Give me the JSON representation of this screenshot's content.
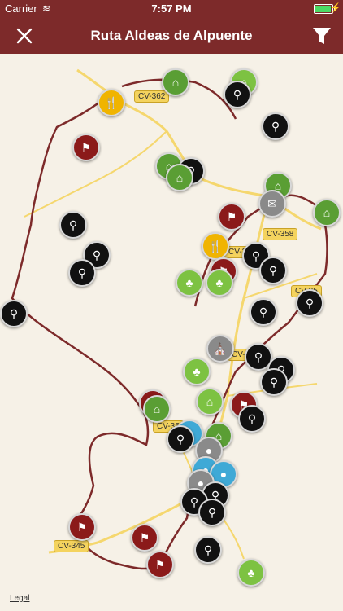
{
  "status": {
    "carrier": "Carrier",
    "time": "7:57 PM"
  },
  "navbar": {
    "title": "Ruta Aldeas de Alpuente"
  },
  "roads": [
    "CV-362",
    "CV-358",
    "CV-35",
    "CV-35",
    "CV-35",
    "CV-35",
    "CV-345"
  ],
  "legal": "Legal",
  "icons": {
    "search": "magnifier-icon",
    "campsite": "campsite-icon",
    "picnic": "picnic-icon",
    "restaurant": "restaurant-icon",
    "info": "info-icon",
    "close": "close-icon",
    "filter": "filter-icon"
  }
}
